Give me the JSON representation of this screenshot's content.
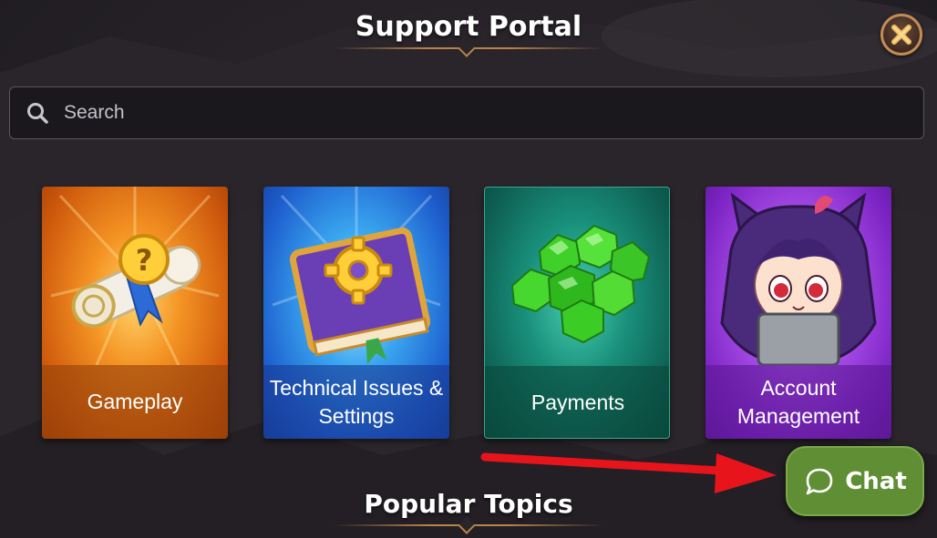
{
  "header": {
    "title": "Support Portal"
  },
  "search": {
    "placeholder": "Search"
  },
  "categories": [
    {
      "label": "Gameplay"
    },
    {
      "label": "Technical Issues & Settings"
    },
    {
      "label": "Payments"
    },
    {
      "label": "Account Management"
    }
  ],
  "popular": {
    "title": "Popular Topics"
  },
  "chat": {
    "label": "Chat"
  },
  "colors": {
    "accent_gold": "#b8844a",
    "chat_green": "#5f8e34",
    "annotation_red": "#e8141c",
    "background": "#262228"
  },
  "icons": {
    "close": "close-icon",
    "search": "search-icon",
    "chat": "chat-bubble-icon"
  }
}
